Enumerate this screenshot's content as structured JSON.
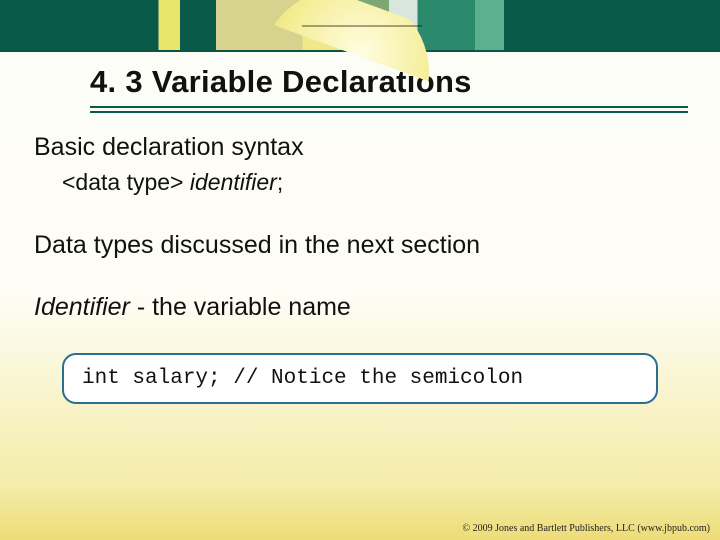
{
  "title": "4. 3 Variable Declarations",
  "lines": {
    "intro": "Basic declaration syntax",
    "syntax_prefix": "<data type> ",
    "syntax_identifier": "identifier",
    "syntax_suffix": ";",
    "data_types": "Data types discussed in the next section",
    "identifier_word": "Identifier",
    "identifier_rest": " - the variable name"
  },
  "code": "int salary; // Notice the semicolon",
  "footer": "© 2009 Jones and Bartlett Publishers, LLC (www.jbpub.com)"
}
